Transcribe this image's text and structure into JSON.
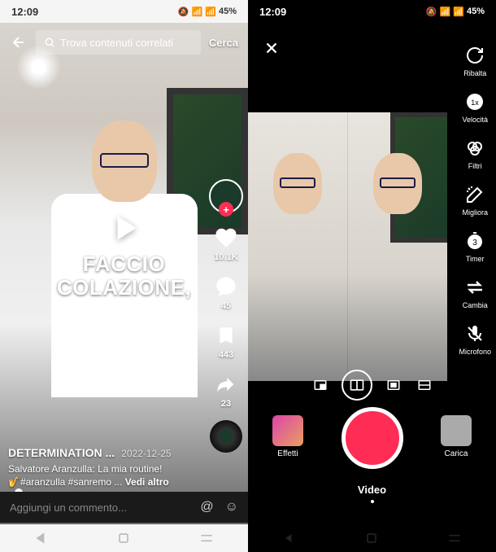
{
  "status": {
    "time": "12:09",
    "battery": "45%",
    "icons": "🔕 📶 📶"
  },
  "feed": {
    "search_placeholder": "Trova contenuti correlati",
    "search_btn": "Cerca",
    "caption_line1": "FACCIO",
    "caption_line2": "COLAZIONE,",
    "likes": "10.1K",
    "comments": "45",
    "bookmarks": "443",
    "shares": "23",
    "author": "DETERMINATION ...",
    "date": "2022-12-25",
    "desc_line1": "Salvatore Aranzulla: La mia routine!",
    "desc_line2": "🎷#aranzulla #sanremo ...",
    "see_more": "Vedi altro",
    "comment_placeholder": "Aggiungi un commento..."
  },
  "camera": {
    "tools": {
      "flip": "Ribalta",
      "speed": "Velocità",
      "filters": "Filtri",
      "enhance": "Migliora",
      "timer": "Timer",
      "switch": "Cambia",
      "mic": "Microfono"
    },
    "effects_label": "Effetti",
    "upload_label": "Carica",
    "mode": "Video"
  }
}
